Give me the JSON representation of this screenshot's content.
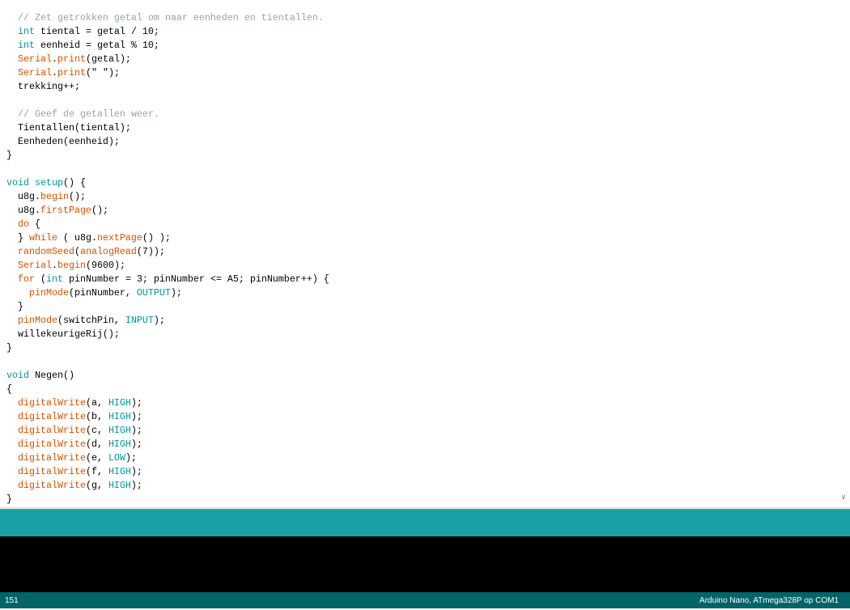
{
  "editor": {
    "lines": [
      [
        [
          "comment",
          "  // Zet getrokken getal om naar eenheden en tientallen."
        ]
      ],
      [
        [
          "plain",
          "  "
        ],
        [
          "kw",
          "int"
        ],
        [
          "plain",
          " tiental = getal / 10;"
        ]
      ],
      [
        [
          "plain",
          "  "
        ],
        [
          "kw",
          "int"
        ],
        [
          "plain",
          " eenheid = getal % 10;"
        ]
      ],
      [
        [
          "plain",
          "  "
        ],
        [
          "fn",
          "Serial"
        ],
        [
          "plain",
          "."
        ],
        [
          "fn",
          "print"
        ],
        [
          "plain",
          "(getal);"
        ]
      ],
      [
        [
          "plain",
          "  "
        ],
        [
          "fn",
          "Serial"
        ],
        [
          "plain",
          "."
        ],
        [
          "fn",
          "print"
        ],
        [
          "plain",
          "(\" \");"
        ]
      ],
      [
        [
          "plain",
          "  trekking++;"
        ]
      ],
      [],
      [
        [
          "comment",
          "  // Geef de getallen weer."
        ]
      ],
      [
        [
          "plain",
          "  Tientallen(tiental);"
        ]
      ],
      [
        [
          "plain",
          "  Eenheden(eenheid);"
        ]
      ],
      [
        [
          "plain",
          "}"
        ]
      ],
      [],
      [
        [
          "kw",
          "void"
        ],
        [
          "plain",
          " "
        ],
        [
          "kw",
          "setup"
        ],
        [
          "plain",
          "() {"
        ]
      ],
      [
        [
          "plain",
          "  u8g."
        ],
        [
          "fn",
          "begin"
        ],
        [
          "plain",
          "();"
        ]
      ],
      [
        [
          "plain",
          "  u8g."
        ],
        [
          "fn",
          "firstPage"
        ],
        [
          "plain",
          "();"
        ]
      ],
      [
        [
          "plain",
          "  "
        ],
        [
          "fn",
          "do"
        ],
        [
          "plain",
          " {"
        ]
      ],
      [
        [
          "plain",
          "  } "
        ],
        [
          "fn",
          "while"
        ],
        [
          "plain",
          " ( u8g."
        ],
        [
          "fn",
          "nextPage"
        ],
        [
          "plain",
          "() );"
        ]
      ],
      [
        [
          "plain",
          "  "
        ],
        [
          "fn",
          "randomSeed"
        ],
        [
          "plain",
          "("
        ],
        [
          "fn",
          "analogRead"
        ],
        [
          "plain",
          "(7));"
        ]
      ],
      [
        [
          "plain",
          "  "
        ],
        [
          "fn",
          "Serial"
        ],
        [
          "plain",
          "."
        ],
        [
          "fn",
          "begin"
        ],
        [
          "plain",
          "(9600);"
        ]
      ],
      [
        [
          "plain",
          "  "
        ],
        [
          "fn",
          "for"
        ],
        [
          "plain",
          " ("
        ],
        [
          "kw",
          "int"
        ],
        [
          "plain",
          " pinNumber = 3; pinNumber <= A5; pinNumber++) {"
        ]
      ],
      [
        [
          "plain",
          "    "
        ],
        [
          "fn",
          "pinMode"
        ],
        [
          "plain",
          "(pinNumber, "
        ],
        [
          "const",
          "OUTPUT"
        ],
        [
          "plain",
          ");"
        ]
      ],
      [
        [
          "plain",
          "  }"
        ]
      ],
      [
        [
          "plain",
          "  "
        ],
        [
          "fn",
          "pinMode"
        ],
        [
          "plain",
          "(switchPin, "
        ],
        [
          "const",
          "INPUT"
        ],
        [
          "plain",
          ");"
        ]
      ],
      [
        [
          "plain",
          "  willekeurigeRij();"
        ]
      ],
      [
        [
          "plain",
          "}"
        ]
      ],
      [],
      [
        [
          "kw",
          "void"
        ],
        [
          "plain",
          " Negen()"
        ]
      ],
      [
        [
          "plain",
          "{"
        ]
      ],
      [
        [
          "plain",
          "  "
        ],
        [
          "fn",
          "digitalWrite"
        ],
        [
          "plain",
          "(a, "
        ],
        [
          "const",
          "HIGH"
        ],
        [
          "plain",
          ");"
        ]
      ],
      [
        [
          "plain",
          "  "
        ],
        [
          "fn",
          "digitalWrite"
        ],
        [
          "plain",
          "(b, "
        ],
        [
          "const",
          "HIGH"
        ],
        [
          "plain",
          ");"
        ]
      ],
      [
        [
          "plain",
          "  "
        ],
        [
          "fn",
          "digitalWrite"
        ],
        [
          "plain",
          "(c, "
        ],
        [
          "const",
          "HIGH"
        ],
        [
          "plain",
          ");"
        ]
      ],
      [
        [
          "plain",
          "  "
        ],
        [
          "fn",
          "digitalWrite"
        ],
        [
          "plain",
          "(d, "
        ],
        [
          "const",
          "HIGH"
        ],
        [
          "plain",
          ");"
        ]
      ],
      [
        [
          "plain",
          "  "
        ],
        [
          "fn",
          "digitalWrite"
        ],
        [
          "plain",
          "(e, "
        ],
        [
          "const",
          "LOW"
        ],
        [
          "plain",
          ");"
        ]
      ],
      [
        [
          "plain",
          "  "
        ],
        [
          "fn",
          "digitalWrite"
        ],
        [
          "plain",
          "(f, "
        ],
        [
          "const",
          "HIGH"
        ],
        [
          "plain",
          ");"
        ]
      ],
      [
        [
          "plain",
          "  "
        ],
        [
          "fn",
          "digitalWrite"
        ],
        [
          "plain",
          "(g, "
        ],
        [
          "const",
          "HIGH"
        ],
        [
          "plain",
          ");"
        ]
      ],
      [
        [
          "plain",
          "}"
        ]
      ]
    ]
  },
  "scrollbar": {
    "down_arrow": "∨"
  },
  "status_bar": {
    "line_number": "151",
    "board": "Arduino Nano, ATmega328P op COM1"
  },
  "colors": {
    "comment": "#95a5a6",
    "keyword": "#00979c",
    "function": "#d35400",
    "message_bar": "#17a1a5",
    "status_bar": "#006468"
  }
}
